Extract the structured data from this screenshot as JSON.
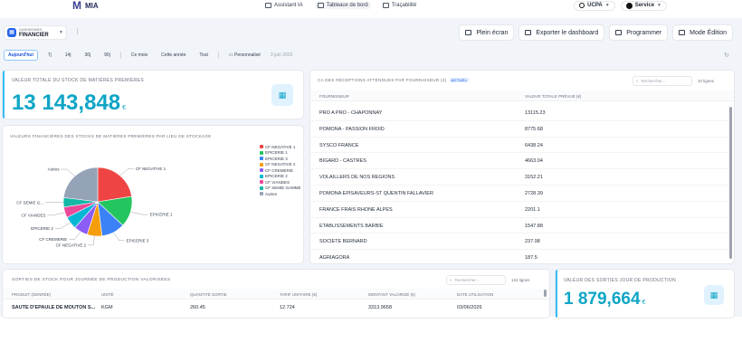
{
  "app": {
    "logo_text": "MIA"
  },
  "nav": [
    {
      "label": "Assistant IA"
    },
    {
      "label": "Tableaux de bord"
    },
    {
      "label": "Traçabilité"
    }
  ],
  "org": {
    "label": "UCPA"
  },
  "user": {
    "label": "Service"
  },
  "dashboard": {
    "small_label": "DASHBOARD",
    "name": "FINANCIER"
  },
  "actions": {
    "fullscreen": "Plein écran",
    "export": "Exporter le dashboard",
    "schedule": "Programmer",
    "edit": "Mode Édition"
  },
  "periods": [
    "Aujourd'hui",
    "7j",
    "14j",
    "30j",
    "90j",
    "Ce mois",
    "Cette année",
    "Tout"
  ],
  "custom_period": "Personnalisé",
  "current_date": "3 juin 2026",
  "kpi_stock": {
    "title": "VALEUR TOTALE DU STOCK DE MATIÈRES PREMIÈRES",
    "value": "13 143,848",
    "unit": "€"
  },
  "kpi_outputs": {
    "title": "VALEUR DES SORTIES JOUR DE PRODUCTION",
    "value": "1 879,664",
    "unit": "€"
  },
  "colors": {
    "accent": "#0ea5c6",
    "primary": "#2563eb"
  },
  "pie_card": {
    "title": "VALEURS FINANCIÈRES DES STOCKS DE MATIÈRES PREMIÈRES PAR LIEU DE STOCKAGE"
  },
  "chart_data": {
    "type": "pie",
    "title": "VALEURS FINANCIÈRES DES STOCKS DE MATIÈRES PREMIÈRES PAR LIEU DE STOCKAGE",
    "legend_position": "right",
    "slices": [
      {
        "label": "CF NEGATIVE 1",
        "value": 22.5,
        "color": "#ef4444"
      },
      {
        "label": "EPICERIE 1",
        "value": 14.5,
        "color": "#22c55e"
      },
      {
        "label": "EPICERIE 3",
        "value": 11.0,
        "color": "#3b82f6"
      },
      {
        "label": "CF NEGATIVE 2",
        "value": 7.0,
        "color": "#f59e0b"
      },
      {
        "label": "CF CREMERIE",
        "value": 6.5,
        "color": "#8b5cf6"
      },
      {
        "label": "EPICERIE 2",
        "value": 6.0,
        "color": "#06b6d4"
      },
      {
        "label": "CF VIANDES",
        "value": 5.0,
        "color": "#ec4899"
      },
      {
        "label": "CF SEMIE GAMME",
        "value": 4.5,
        "color": "#14b8a6"
      },
      {
        "label": "Autres",
        "value": 23.0,
        "color": "#94a3b8"
      }
    ],
    "callouts": [
      "CF NEGATIVE 1",
      "EPICERIE 1",
      "EPICERIE 3",
      "CF NEGATIVE 2",
      "CF CREMERIE",
      "EPICERIE 2",
      "CF VIANDES",
      "CF SEMIE G...",
      "Autres"
    ]
  },
  "receptions": {
    "title": "CA DES RÉCEPTIONS ATTENDUES PAR FOURNISSEUR (2)",
    "badge": "Actuel",
    "search_placeholder": "Rechercher...",
    "count": "10 lignes",
    "columns": [
      "FOURNISSEUR",
      "VALEUR TOTALE PRÉVUE (€)"
    ],
    "rows": [
      [
        "PRO A PRO - CHAPONNAY",
        "13115.23"
      ],
      [
        "POMONA - PASSION FROID",
        "8775.68"
      ],
      [
        "SYSCO FRANCE",
        "6438.24"
      ],
      [
        "BIGARD - CASTRES",
        "4663.04"
      ],
      [
        "VOLAILLERS DE NOS REGIONS",
        "3152.21"
      ],
      [
        "POMONA EPISAVEURS-ST QUENTIN FALLAVIER",
        "2728.39"
      ],
      [
        "FRANCE FRAIS RHONE ALPES",
        "2201.1"
      ],
      [
        "ETABLISSEMENTS BARBIE",
        "1547.88"
      ],
      [
        "SOCIETE BERNARD",
        "237.98"
      ],
      [
        "AGRIAGORA",
        "187.5"
      ]
    ]
  },
  "outputs": {
    "title": "SORTIES DE STOCK POUR JOURNÉE DE PRODUCTION VALORISÉES",
    "search_placeholder": "Rechercher...",
    "count": "124 lignes",
    "columns": [
      "PRODUIT (DENRÉE)",
      "UNITÉ",
      "QUANTITÉ SORTIE",
      "TARIF UNITAIRE (€)",
      "MONTANT VALORISÉ (€)",
      "DATE UTILISATION"
    ],
    "rows": [
      [
        "SAUTE D'EPAULE DE MOUTON S...",
        "KGM",
        "260.45",
        "12.724",
        "3313.9658",
        "03/06/2026"
      ]
    ]
  }
}
